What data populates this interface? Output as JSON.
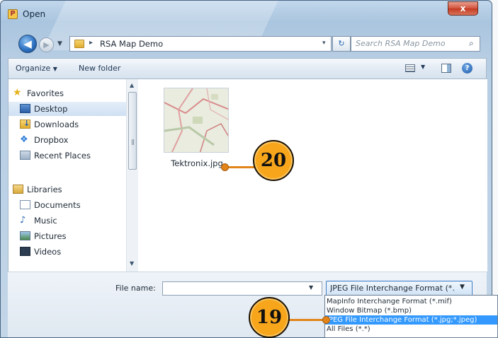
{
  "window": {
    "title": "Open",
    "close_label": "x"
  },
  "address_bar": {
    "back_glyph": "◀",
    "forward_glyph": "▶",
    "history_glyph": "▼",
    "breadcrumb_arrow": "▸",
    "path": "RSA Map Demo",
    "dropdown_glyph": "▾",
    "refresh_glyph": "↻"
  },
  "search": {
    "placeholder": "Search RSA Map Demo",
    "icon": "search-icon"
  },
  "toolbar": {
    "organize_label": "Organize",
    "new_folder_label": "New folder",
    "help_glyph": "?"
  },
  "nav": {
    "favorites": {
      "label": "Favorites",
      "icon": "star-icon"
    },
    "favorite_items": [
      {
        "label": "Desktop",
        "icon": "desktop-icon",
        "selected": true
      },
      {
        "label": "Downloads",
        "icon": "downloads-icon"
      },
      {
        "label": "Dropbox",
        "icon": "dropbox-icon"
      },
      {
        "label": "Recent Places",
        "icon": "recent-places-icon"
      }
    ],
    "libraries": {
      "label": "Libraries",
      "icon": "libraries-icon"
    },
    "library_items": [
      {
        "label": "Documents",
        "icon": "documents-icon"
      },
      {
        "label": "Music",
        "icon": "music-icon"
      },
      {
        "label": "Pictures",
        "icon": "pictures-icon"
      },
      {
        "label": "Videos",
        "icon": "videos-icon"
      }
    ]
  },
  "files": [
    {
      "name": "Tektronix.jpg",
      "icon": "map-thumbnail"
    }
  ],
  "file_name": {
    "label": "File name:",
    "value": ""
  },
  "file_type": {
    "selected": "JPEG File Interchange Format (*.jpg;*.jpeg)",
    "options": [
      "MapInfo Interchange Format (*.mif)",
      "Window Bitmap (*.bmp)",
      "JPEG File Interchange Format (*.jpg;*.jpeg)",
      "All Files (*.*)"
    ],
    "highlighted_index": 2
  },
  "annotations": [
    {
      "number": "20",
      "target": "Tektronix.jpg"
    },
    {
      "number": "19",
      "target": "JPEG File Interchange Format option"
    }
  ],
  "colors": {
    "callout_fill": "#f7a51b",
    "leader": "#e2841a",
    "selection": "#3399ff",
    "close_button": "#c33b22"
  }
}
